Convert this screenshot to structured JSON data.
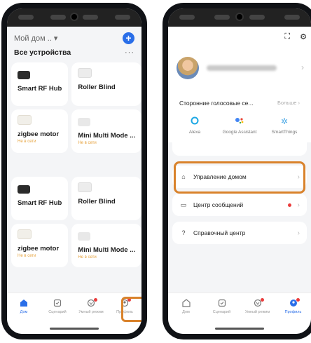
{
  "left": {
    "home_selector": "Мой дом .. ▾",
    "section_title": "Все устройства",
    "devices": [
      {
        "name": "Smart RF Hub",
        "status": ""
      },
      {
        "name": "Roller Blind",
        "status": ""
      },
      {
        "name": "zigbee motor",
        "status": "Не в сети"
      },
      {
        "name": "Mini Multi Mode ...",
        "status": "Не в сети"
      },
      {
        "name": "Smart RF Hub",
        "status": ""
      },
      {
        "name": "Roller Blind",
        "status": ""
      },
      {
        "name": "zigbee motor",
        "status": "Не в сети"
      },
      {
        "name": "Mini Multi Mode ...",
        "status": "Не в сети"
      }
    ],
    "tabs": [
      "Дом",
      "Сценарий",
      "Умный режим",
      "Профиль"
    ]
  },
  "right": {
    "voice_title": "Сторонние голосовые се...",
    "voice_more": "Больше",
    "assistants": [
      "Alexa",
      "Google Assistant",
      "SmartThings"
    ],
    "menu": [
      "Управление домом",
      "Центр сообщений",
      "Справочный центр"
    ],
    "tabs": [
      "Дом",
      "Сценарий",
      "Умный режим",
      "Профиль"
    ]
  },
  "colors": {
    "accent": "#2a6ee8",
    "highlight": "#d9822b",
    "offline": "#e6a23c",
    "badge": "#ea3c3c"
  }
}
